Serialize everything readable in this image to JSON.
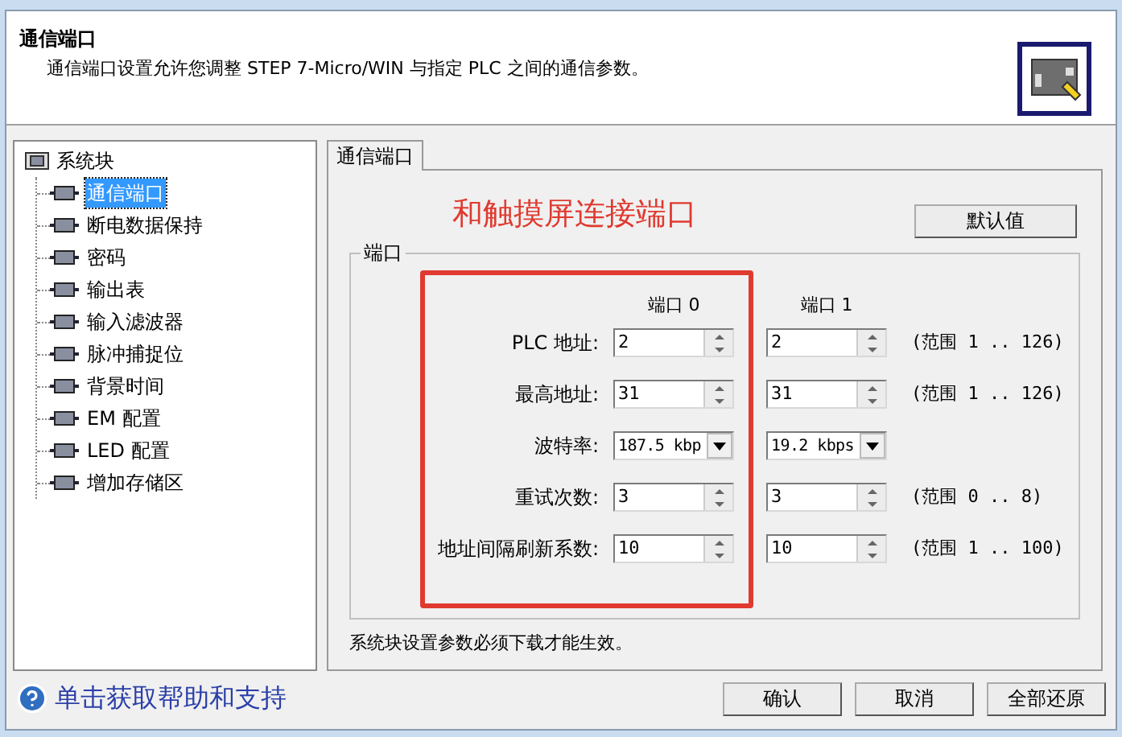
{
  "header": {
    "title": "通信端口",
    "description": "通信端口设置允许您调整 STEP 7-Micro/WIN 与指定 PLC 之间的通信参数。"
  },
  "tree": {
    "label": "系统块",
    "children": [
      {
        "label": "通信端口",
        "selected": true
      },
      {
        "label": "断电数据保持",
        "selected": false
      },
      {
        "label": "密码",
        "selected": false
      },
      {
        "label": "输出表",
        "selected": false
      },
      {
        "label": "输入滤波器",
        "selected": false
      },
      {
        "label": "脉冲捕捉位",
        "selected": false
      },
      {
        "label": "背景时间",
        "selected": false
      },
      {
        "label": "EM 配置",
        "selected": false
      },
      {
        "label": "LED 配置",
        "selected": false
      },
      {
        "label": "增加存储区",
        "selected": false
      }
    ]
  },
  "tabs": [
    {
      "label": "通信端口",
      "selected": true
    }
  ],
  "annotation": "和触摸屏连接端口",
  "default_button": "默认值",
  "group": {
    "legend": "端口",
    "columns": [
      "端口 0",
      "端口 1"
    ],
    "rows": [
      {
        "label": "PLC 地址:",
        "kind": "spin",
        "values": [
          "2",
          "2"
        ],
        "range": "(范围 1 .. 126)"
      },
      {
        "label": "最高地址:",
        "kind": "spin",
        "values": [
          "31",
          "31"
        ],
        "range": "(范围 1 .. 126)"
      },
      {
        "label": "波特率:",
        "kind": "dropdown",
        "values": [
          "187.5 kbp",
          "19.2 kbps"
        ]
      },
      {
        "label": "重试次数:",
        "kind": "spin",
        "values": [
          "3",
          "3"
        ],
        "range": "(范围 0 .. 8)"
      },
      {
        "label": "地址间隔刷新系数:",
        "kind": "spin",
        "values": [
          "10",
          "10"
        ],
        "range": "(范围 1 .. 100)"
      }
    ]
  },
  "note": "系统块设置参数必须下载才能生效。",
  "help_link": "单击获取帮助和支持",
  "buttons": [
    "确认",
    "取消",
    "全部还原"
  ]
}
